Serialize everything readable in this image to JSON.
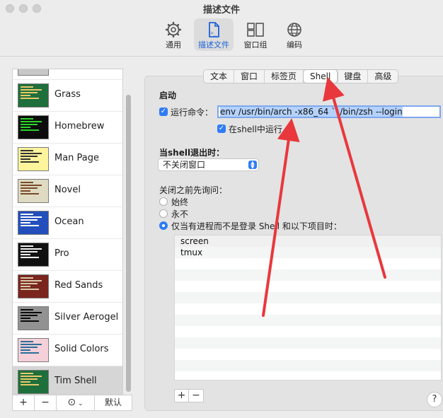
{
  "window": {
    "title": "描述文件"
  },
  "toolbar": {
    "items": [
      {
        "label": "通用",
        "icon": "gear-icon"
      },
      {
        "label": "描述文件",
        "icon": "document-icon"
      },
      {
        "label": "窗口组",
        "icon": "window-group-icon"
      },
      {
        "label": "编码",
        "icon": "globe-icon"
      }
    ],
    "active_index": 1
  },
  "sidebar": {
    "profiles": [
      {
        "name": "Grass",
        "bg": "#1e6f3b",
        "fg": "#e8c86a"
      },
      {
        "name": "Homebrew",
        "bg": "#0c0c0c",
        "fg": "#2bd52b"
      },
      {
        "name": "Man Page",
        "bg": "#fef49c",
        "fg": "#333333"
      },
      {
        "name": "Novel",
        "bg": "#dfdbc3",
        "fg": "#7a4a2a"
      },
      {
        "name": "Ocean",
        "bg": "#224fbc",
        "fg": "#ffffff"
      },
      {
        "name": "Pro",
        "bg": "#111111",
        "fg": "#f2f2f2"
      },
      {
        "name": "Red Sands",
        "bg": "#7a251e",
        "fg": "#d7c9a7"
      },
      {
        "name": "Silver Aerogel",
        "bg": "#929292",
        "fg": "#0a0a0a"
      },
      {
        "name": "Solid Colors",
        "bg": "#f6d0d8",
        "fg": "#2a6f9c"
      },
      {
        "name": "Tim Shell",
        "bg": "#1e6f3b",
        "fg": "#e8c86a"
      }
    ],
    "selected": "Tim Shell",
    "footer": {
      "add": "+",
      "remove": "−",
      "more": "⊙",
      "default_label": "默认"
    }
  },
  "tabs": {
    "items": [
      "文本",
      "窗口",
      "标签页",
      "Shell",
      "键盘",
      "高级"
    ],
    "active": "Shell"
  },
  "shell": {
    "startup_heading": "启动",
    "run_command_label": "运行命令：",
    "run_command_checked": true,
    "run_command_value": "env /usr/bin/arch -x86_64 ``/bin/zsh --login",
    "run_in_shell_label": "在shell中运行",
    "run_in_shell_checked": true,
    "on_exit_heading_pre": "当",
    "on_exit_heading_bold": "shell",
    "on_exit_heading_post": "退出时：",
    "on_exit_value": "不关闭窗口",
    "ask_before_heading": "关闭之前先询问：",
    "ask_options": [
      "始终",
      "永不",
      "仅当有进程而不是登录 Shell 和以下项目时："
    ],
    "ask_selected": 2,
    "processes": [
      "screen",
      "tmux"
    ],
    "list_add": "+",
    "list_remove": "−",
    "help": "?"
  },
  "colors": {
    "accent": "#2f7cf6",
    "annotation": "#e8383d"
  }
}
